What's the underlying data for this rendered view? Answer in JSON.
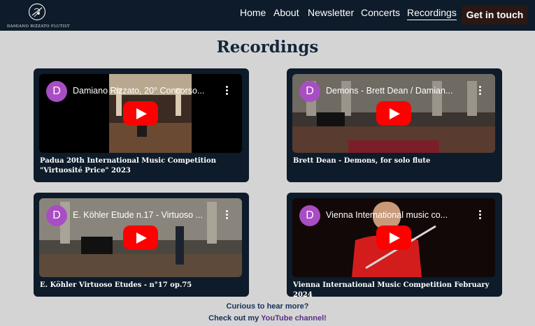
{
  "header": {
    "brand": "DAMIANO RIZZATO FLUTIST",
    "nav": [
      "Home",
      "About",
      "Newsletter",
      "Concerts",
      "Recordings"
    ],
    "active": "Recordings",
    "cta_label": "Get in touch"
  },
  "page": {
    "title": "Recordings"
  },
  "videos": [
    {
      "channel_initial": "D",
      "video_title": "Damiano Rizzato, 20° Concorso...",
      "caption": "Padua 20th International Music Competition \"Virtuosité Price\" 2023"
    },
    {
      "channel_initial": "D",
      "video_title": "Demons - Brett Dean / Damian...",
      "caption": "Brett Dean - Demons, for solo flute"
    },
    {
      "channel_initial": "D",
      "video_title": "E. Köhler Etude n.17 - Virtuoso ...",
      "caption": "E. Köhler Virtuoso Etudes - n°17 op.75"
    },
    {
      "channel_initial": "D",
      "video_title": "Vienna International music co...",
      "caption": "Vienna International Music Competition February 2024"
    }
  ],
  "footer": {
    "line1": "Curious to hear more?",
    "line2_prefix": "Check out my ",
    "line2_link": "YouTube channel!"
  },
  "colors": {
    "navbar": "#0d1b2a",
    "background": "#d4d4d4",
    "cta": "#2b1714",
    "play_button": "#ff0000",
    "avatar": "#a94dc4"
  },
  "icons": [
    "brand-logo-icon",
    "kebab-menu-icon",
    "play-icon"
  ]
}
